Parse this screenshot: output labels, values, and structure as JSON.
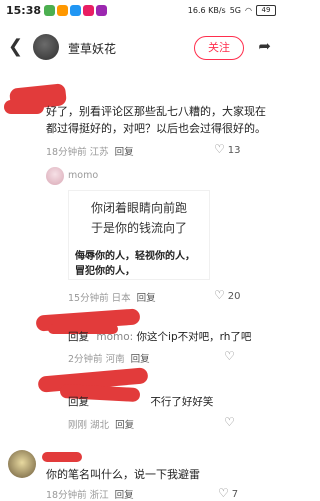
{
  "status_bar": {
    "time": "15:38",
    "network": "16.6 KB/s",
    "signal": "5G",
    "battery": "49"
  },
  "header": {
    "username": "萱草妖花",
    "follow_label": "关注"
  },
  "comments": [
    {
      "text": "好了，别看评论区那些乱七八糟的，大家现在都过得挺好的，对吧？以后也会过得很好的。",
      "time": "18分钟前",
      "location": "江苏",
      "reply": "回复",
      "likes": "13"
    },
    {
      "username": "momo",
      "image_line1": "你闭着眼睛向前跑",
      "image_line2": "于是你的钱流向了",
      "image_text": "侮辱你的人，轻视你的人，冒犯你的人，",
      "time": "15分钟前",
      "location": "日本",
      "reply": "回复",
      "likes": "20"
    },
    {
      "reply_prefix": "回复",
      "target": "momo:",
      "text": "你这个ip不对吧，rh了吧",
      "time": "2分钟前",
      "location": "河南",
      "reply": "回复",
      "likes": ""
    },
    {
      "reply_prefix": "回复",
      "text": "不行了好好笑",
      "time": "刚刚",
      "location": "湖北",
      "reply": "回复",
      "likes": ""
    },
    {
      "text": "你的笔名叫什么，说一下我避雷",
      "time": "18分钟前",
      "location": "浙江",
      "reply": "回复",
      "likes": "7"
    }
  ],
  "colors": {
    "accent": "#ff2e4d",
    "redaction": "#e23b3b"
  },
  "icons": {
    "back": "chevron-left-icon",
    "share": "share-icon",
    "like": "heart-icon"
  }
}
